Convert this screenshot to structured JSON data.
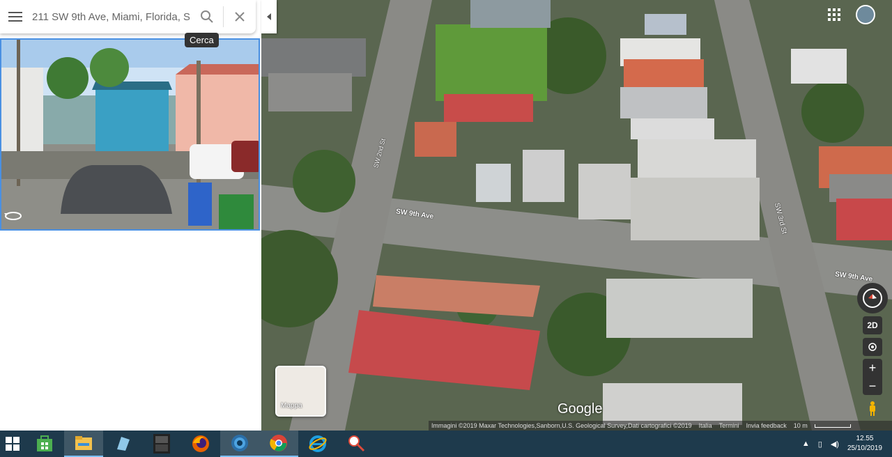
{
  "search": {
    "value": "211 SW 9th Ave, Miami, Florida, S",
    "tooltip": "Cerca",
    "icons": [
      "menu-icon",
      "search-icon",
      "close-icon"
    ]
  },
  "map": {
    "street_labels": [
      "SW 2nd St",
      "SW 9th Ave",
      "SW 3rd St",
      "SW 9th Ave"
    ],
    "minimap_label": "Mappa",
    "logo": "Google",
    "view_toggle": "2D",
    "attribution": {
      "imagery": "Immagini ©2019 Maxar Technologies,Sanborn,U.S. Geological Survey,Dati cartografici ©2019",
      "country": "Italia",
      "terms": "Termini",
      "feedback": "Invia feedback",
      "scale": "10 m"
    }
  },
  "taskbar": {
    "apps": [
      "windows-icon",
      "store-icon",
      "file-explorer-icon",
      "app-icon",
      "dgtnic-icon",
      "firefox-icon",
      "app-disc-icon",
      "chrome-icon",
      "internet-explorer-icon",
      "snipping-tool-icon"
    ],
    "time": "12.55",
    "date": "25/10/2019"
  },
  "colors": {
    "taskbar": "#1e3a4c",
    "accent": "#4a90e2"
  }
}
